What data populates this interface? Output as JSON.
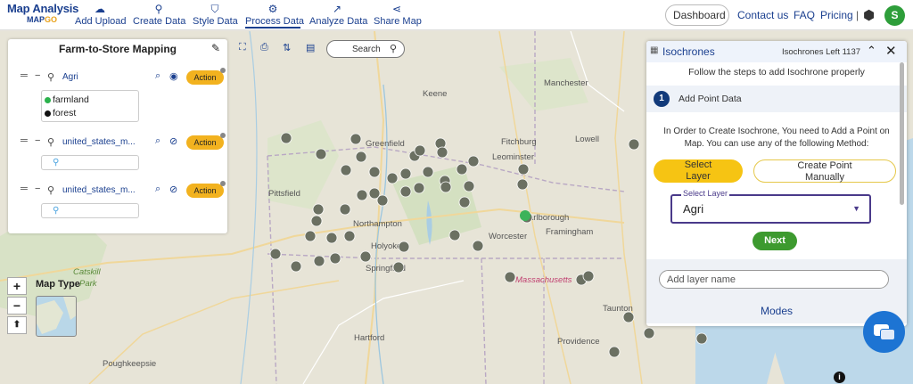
{
  "app": {
    "logo_line1": "Map Analysis",
    "logo_line2a": "MAP",
    "logo_line2b": "GO"
  },
  "nav": [
    {
      "label": "Add Upload",
      "icon": "cloud-upload-icon"
    },
    {
      "label": "Create Data",
      "icon": "map-pin-icon"
    },
    {
      "label": "Style Data",
      "icon": "paint-bucket-icon"
    },
    {
      "label": "Process Data",
      "icon": "process-icon"
    },
    {
      "label": "Analyze Data",
      "icon": "analyze-icon"
    },
    {
      "label": "Share Map",
      "icon": "share-icon"
    }
  ],
  "topright": {
    "dashboard": "Dashboard",
    "contact": "Contact us",
    "faq": "FAQ",
    "pricing": "Pricing",
    "avatar_initial": "S"
  },
  "layer_panel": {
    "title": "Farm-to-Store Mapping",
    "layers": [
      {
        "name": "Agri",
        "action": "Action"
      },
      {
        "name": "united_states_m...",
        "action": "Action"
      },
      {
        "name": "united_states_m...",
        "action": "Action"
      }
    ],
    "legend": [
      {
        "label": "farmland",
        "color": "#2bb24c"
      },
      {
        "label": "forest",
        "color": "#111111"
      }
    ]
  },
  "search": {
    "label": "Search"
  },
  "map": {
    "type_label": "Map Type",
    "towns": [
      "Keene",
      "Manchester",
      "Greenfield",
      "Fitchburg",
      "Leominster",
      "Lowell",
      "Pittsfield",
      "Northampton",
      "Marlborough",
      "Holyoke",
      "Worcester",
      "Framingham",
      "Springfield",
      "Catskill",
      "Park",
      "Massachusetts",
      "Poughkeepsie",
      "Hartford",
      "Taunton",
      "Providence"
    ],
    "marker_color": "#6b7062"
  },
  "isochrone": {
    "title": "Isochrones",
    "left_label": "Isochrones Left 1137",
    "subtitle": "Follow the steps to add Isochrone properly",
    "step_number": "1",
    "step_label": "Add Point Data",
    "description": "In Order to Create Isochrone, You need to Add a Point on Map. You can use any of the following Method:",
    "btn_select_layer": "Select Layer",
    "btn_create_point": "Create Point Manually",
    "select_label": "Select Layer",
    "select_value": "Agri",
    "next": "Next",
    "add_layer_placeholder": "Add layer name",
    "modes": "Modes"
  }
}
